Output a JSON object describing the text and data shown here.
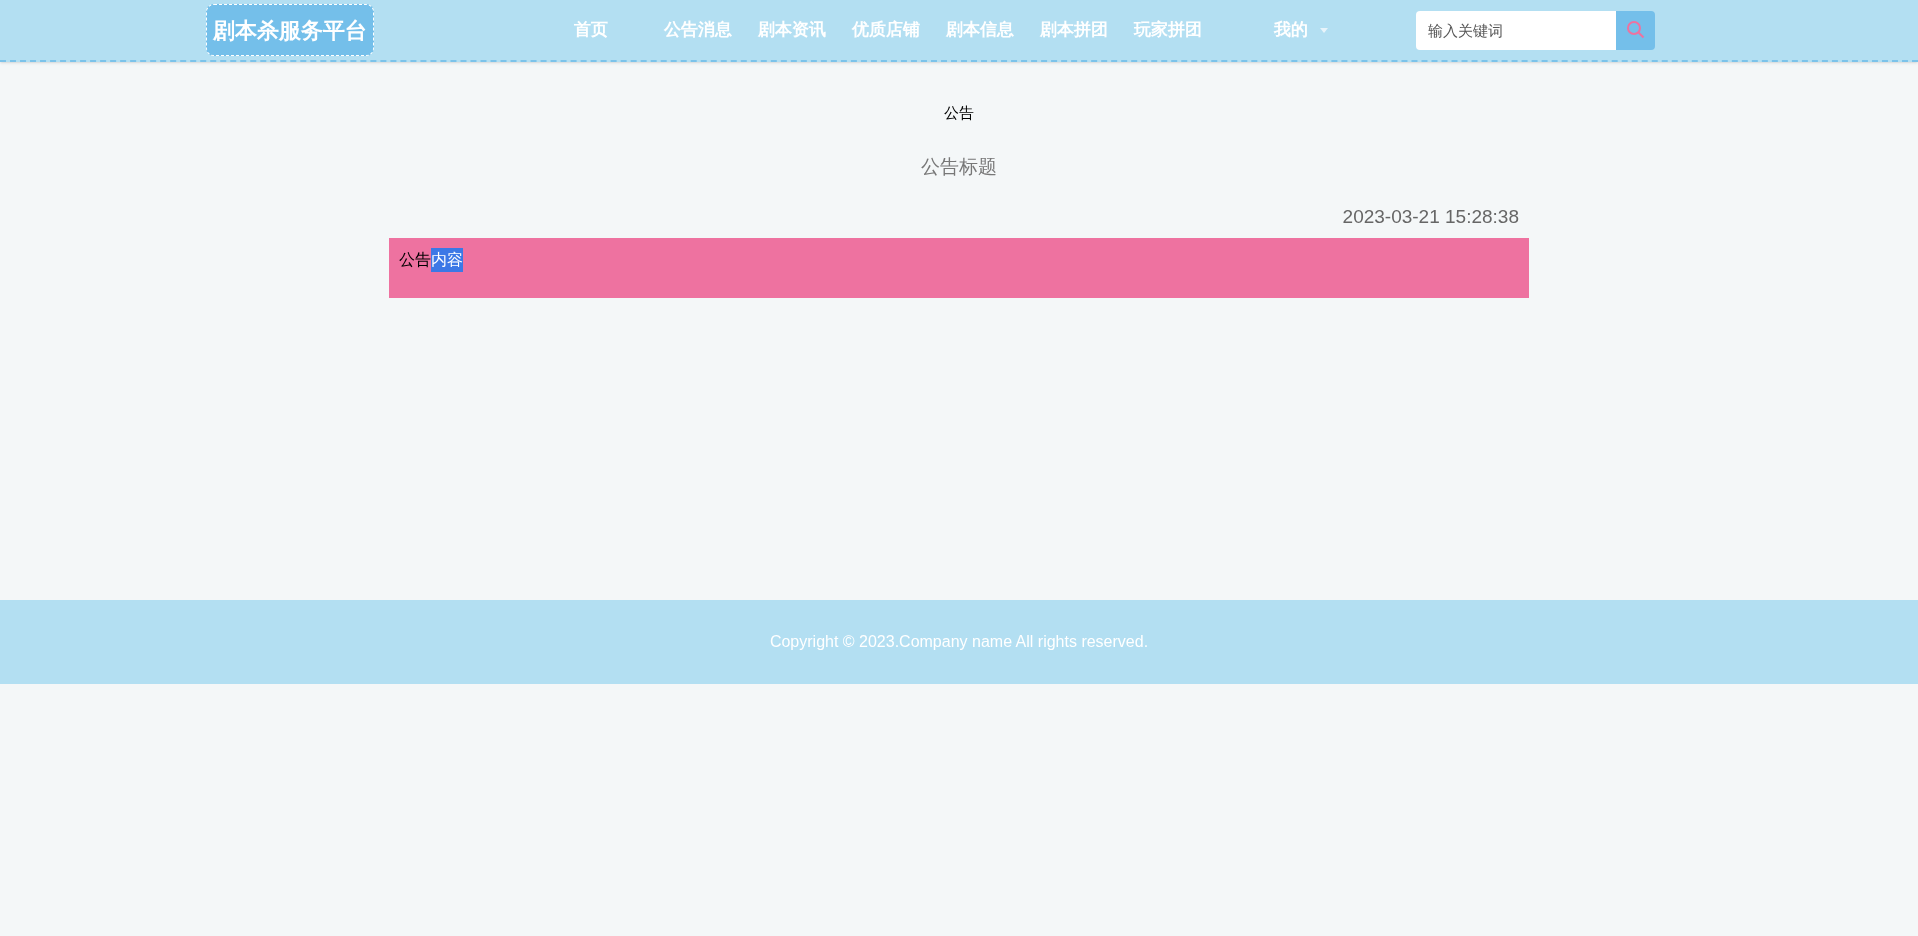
{
  "logo": "剧本杀服务平台",
  "nav": [
    {
      "label": "首页"
    },
    {
      "label": "公告消息"
    },
    {
      "label": "剧本资讯"
    },
    {
      "label": "优质店铺"
    },
    {
      "label": "剧本信息"
    },
    {
      "label": "剧本拼团"
    },
    {
      "label": "玩家拼团"
    }
  ],
  "user_menu": {
    "label": "我的"
  },
  "search": {
    "placeholder": "输入关键词"
  },
  "page_heading": "公告",
  "notice": {
    "title": "公告标题",
    "time": "2023-03-21 15:28:38",
    "content": [
      {
        "text": "公告",
        "selected": false
      },
      {
        "text": "内容",
        "selected": true
      }
    ]
  },
  "footer": "Copyright © 2023.Company name All rights reserved."
}
